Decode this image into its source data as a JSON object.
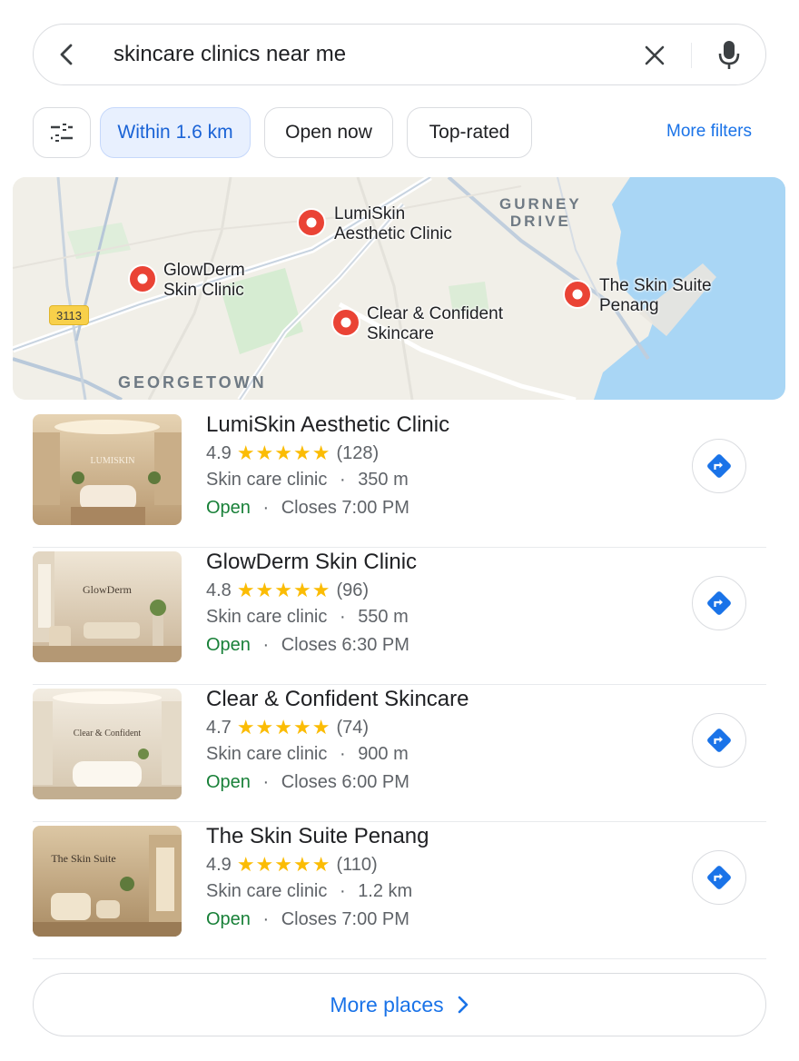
{
  "search": {
    "query": "skincare clinics near me"
  },
  "filters": {
    "chips": [
      "Within 1.6 km",
      "Open now",
      "Top-rated"
    ],
    "active_chip": "Within 1.6 km",
    "more_filters": "More filters"
  },
  "map": {
    "areas": [
      "GEORGETOWN",
      "GURNEY",
      "DRIVE"
    ],
    "route_number": "3113",
    "pins": [
      {
        "label_line1": "LumiSkin",
        "label_line2": "Aesthetic Clinic"
      },
      {
        "label_line1": "GlowDerm",
        "label_line2": "Skin Clinic"
      },
      {
        "label_line1": "Clear & Confident",
        "label_line2": "Skincare"
      },
      {
        "label_line1": "The Skin Suite",
        "label_line2": "Penang"
      }
    ],
    "colors": {
      "land": "#f1efe8",
      "water": "#a9d6f5",
      "park": "#d6ecd2",
      "pin": "#ea4335"
    }
  },
  "places": [
    {
      "name": "LumiSkin Aesthetic Clinic",
      "rating": "4.9",
      "stars": "★★★★★",
      "reviews": "(128)",
      "type": "Skin care clinic",
      "distance": "350 m",
      "status": "Open",
      "closes": "Closes 7:00 PM",
      "thumb_sign": "LUMISKIN"
    },
    {
      "name": "GlowDerm Skin Clinic",
      "rating": "4.8",
      "stars": "★★★★★",
      "reviews": "(96)",
      "type": "Skin care clinic",
      "distance": "550 m",
      "status": "Open",
      "closes": "Closes 6:30 PM",
      "thumb_sign": "GlowDerm"
    },
    {
      "name": "Clear & Confident Skincare",
      "rating": "4.7",
      "stars": "★★★★★",
      "reviews": "(74)",
      "type": "Skin care clinic",
      "distance": "900 m",
      "status": "Open",
      "closes": "Closes 6:00 PM",
      "thumb_sign": "Clear & Confident"
    },
    {
      "name": "The Skin Suite Penang",
      "rating": "4.9",
      "stars": "★★★★★",
      "reviews": "(110)",
      "type": "Skin care clinic",
      "distance": "1.2 km",
      "status": "Open",
      "closes": "Closes 7:00 PM",
      "thumb_sign": "The Skin Suite"
    }
  ],
  "separator": "·",
  "more_places": "More places",
  "icons": [
    "back-arrow-icon",
    "close-icon",
    "microphone-icon",
    "tune-icon",
    "map-pin-icon",
    "directions-icon",
    "chevron-right-icon"
  ],
  "accent_color": "#1a73e8",
  "open_color": "#188038",
  "star_color": "#fbbc04"
}
